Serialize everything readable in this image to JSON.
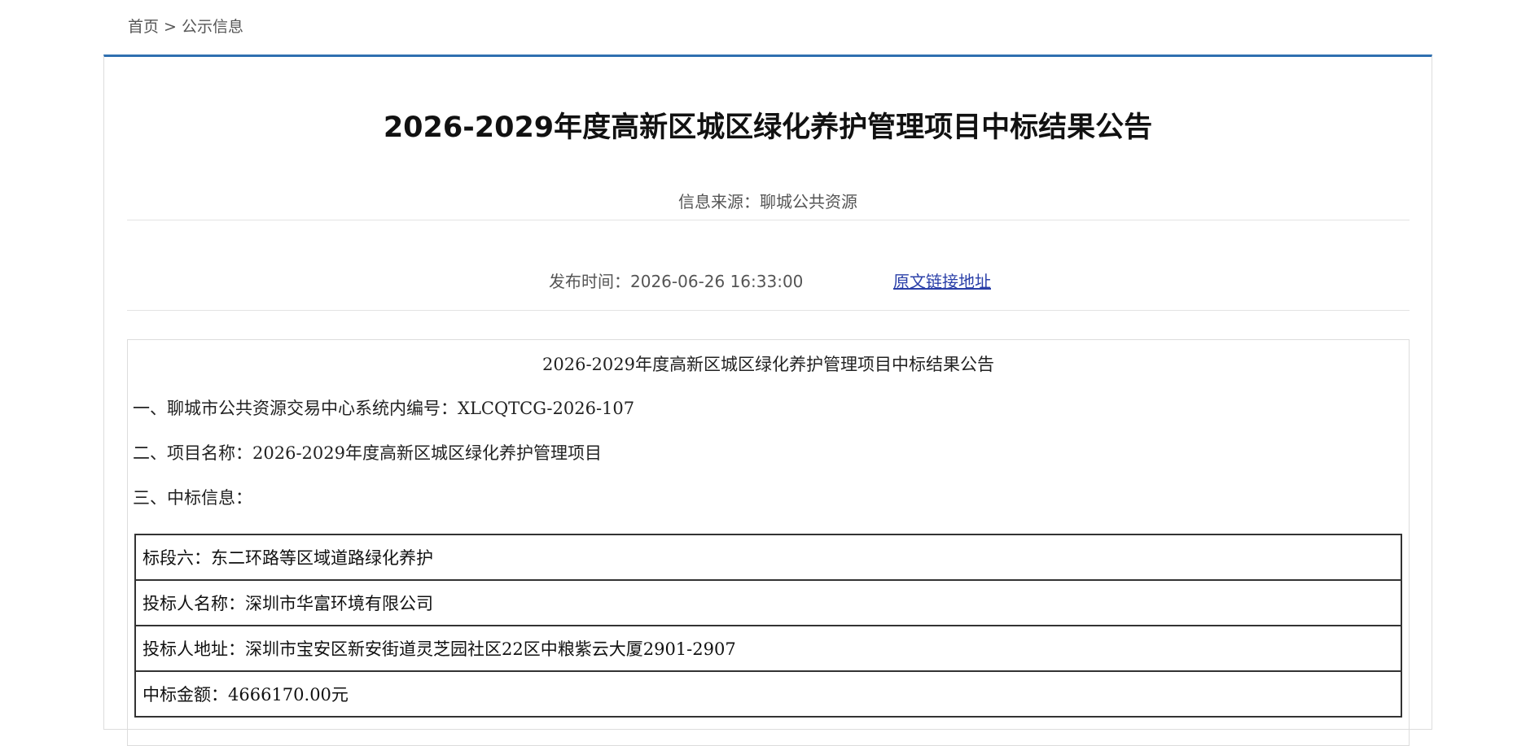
{
  "breadcrumb": {
    "home": "首页",
    "separator": ">",
    "current": "公示信息"
  },
  "article": {
    "title": "2026-2029年度高新区城区绿化养护管理项目中标结果公告",
    "source_text": "信息来源：聊城公共资源",
    "publish_time_text": "发布时间：2026-06-26 16:33:00",
    "original_link_label": "原文链接地址"
  },
  "content": {
    "heading": "2026-2029年度高新区城区绿化养护管理项目中标结果公告",
    "paragraphs": [
      "一、聊城市公共资源交易中心系统内编号：XLCQTCG-2026-107",
      "二、项目名称：2026-2029年度高新区城区绿化养护管理项目",
      "三、中标信息："
    ],
    "table_rows": [
      "标段六：东二环路等区域道路绿化养护",
      "投标人名称：深圳市华富环境有限公司",
      "投标人地址：深圳市宝安区新安街道灵芝园社区22区中粮紫云大厦2901-2907",
      "中标金额：4666170.00元"
    ]
  },
  "colors": {
    "accent": "#2f6fb0",
    "link": "#2a3fa8"
  }
}
